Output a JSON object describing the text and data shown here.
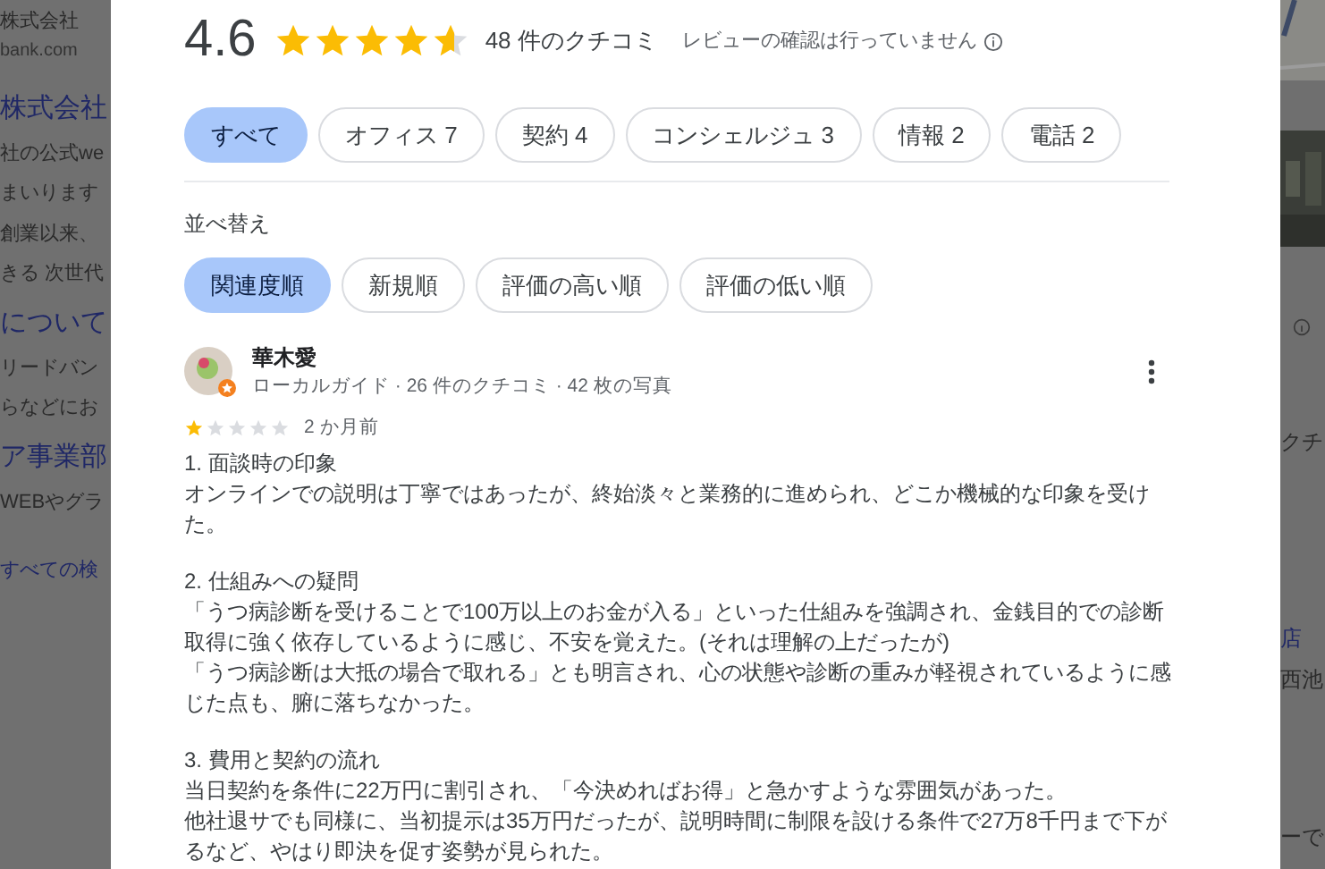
{
  "background_left": [
    {
      "text": "株式会社",
      "kind": "small"
    },
    {
      "text": "bank.com",
      "kind": "url"
    },
    {
      "text": "株式会社",
      "kind": "link"
    },
    {
      "text": "社の公式we",
      "kind": "body"
    },
    {
      "text": "まいります",
      "kind": "body"
    },
    {
      "text": "創業以来、",
      "kind": "body"
    },
    {
      "text": "きる 次世代",
      "kind": "body"
    },
    {
      "text": "について",
      "kind": "link"
    },
    {
      "text": "リードバン",
      "kind": "body"
    },
    {
      "text": "らなどにお",
      "kind": "body"
    },
    {
      "text": "ア事業部",
      "kind": "link"
    },
    {
      "text": "WEBやグラ",
      "kind": "body"
    },
    {
      "text": "すべての検",
      "kind": "more"
    }
  ],
  "background_right": [
    {
      "text": "クチ",
      "kind": "body"
    },
    {
      "text": "店",
      "kind": "link"
    },
    {
      "text": "西池",
      "kind": "body"
    },
    {
      "text": "ーで",
      "kind": "body"
    }
  ],
  "rating": {
    "score": "4.6",
    "stars": 4.6,
    "count": "48 件のクチコミ",
    "note": "レビューの確認は行っていません"
  },
  "topics": [
    {
      "label": "すべて",
      "selected": true
    },
    {
      "label": "オフィス 7",
      "selected": false
    },
    {
      "label": "契約 4",
      "selected": false
    },
    {
      "label": "コンシェルジュ 3",
      "selected": false
    },
    {
      "label": "情報 2",
      "selected": false
    },
    {
      "label": "電話 2",
      "selected": false
    }
  ],
  "sort": {
    "title": "並べ替え",
    "options": [
      {
        "label": "関連度順",
        "selected": true
      },
      {
        "label": "新規順",
        "selected": false
      },
      {
        "label": "評価の高い順",
        "selected": false
      },
      {
        "label": "評価の低い順",
        "selected": false
      }
    ]
  },
  "review": {
    "author": "華木愛",
    "meta": "ローカルガイド · 26 件のクチコミ · 42 枚の写真",
    "stars": 1,
    "time": "2 か月前",
    "sections": [
      {
        "heading": "1. 面談時の印象",
        "lines": [
          "オンラインでの説明は丁寧ではあったが、終始淡々と業務的に進められ、どこか機械的な印象を受けた。"
        ]
      },
      {
        "heading": "2. 仕組みへの疑問",
        "lines": [
          "「うつ病診断を受けることで100万以上のお金が入る」といった仕組みを強調され、金銭目的での診断取得に強く依存しているように感じ、不安を覚えた。(それは理解の上だったが)",
          "「うつ病診断は大抵の場合で取れる」とも明言され、心の状態や診断の重みが軽視されているように感じた点も、腑に落ちなかった。"
        ]
      },
      {
        "heading": "3. 費用と契約の流れ",
        "lines": [
          "当日契約を条件に22万円に割引され、「今決めればお得」と急かすような雰囲気があった。",
          "他社退サでも同様に、当初提示は35万円だったが、説明時間に制限を設ける条件で27万8千円まで下がるなど、やはり即決を促す姿勢が見られた。"
        ]
      }
    ]
  }
}
